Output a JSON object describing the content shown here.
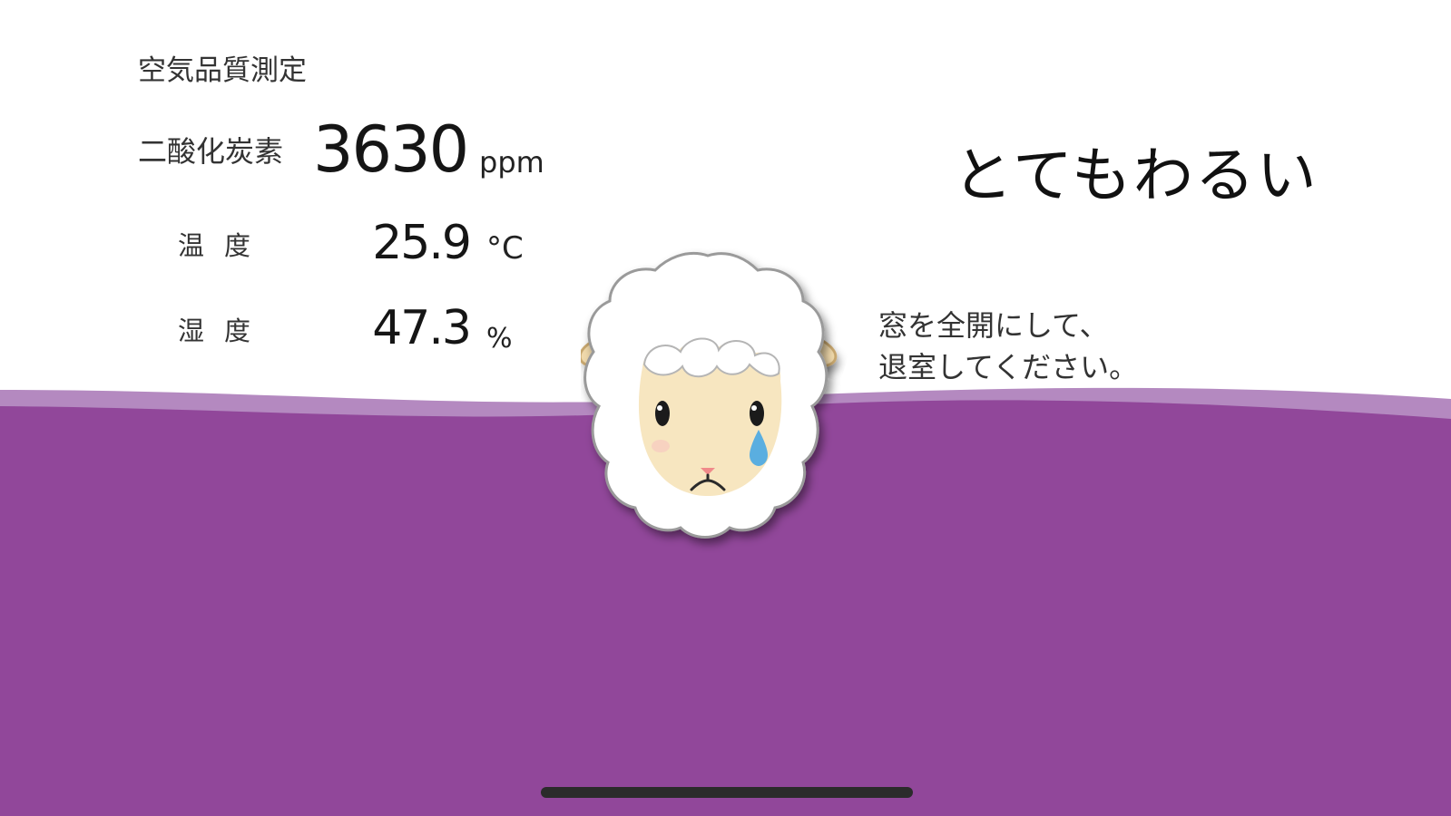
{
  "header": {
    "title": "空気品質測定"
  },
  "readings": {
    "co2": {
      "label": "二酸化炭素",
      "value": "3630",
      "unit": "ppm"
    },
    "temperature": {
      "label": "温度",
      "value": "25.9",
      "unit": "°C"
    },
    "humidity": {
      "label": "湿度",
      "value": "47.3",
      "unit": "%"
    }
  },
  "status": {
    "rating": "とてもわるい",
    "advice_line1": "窓を全開にして、",
    "advice_line2": "退室してください。"
  },
  "mascot": {
    "icon": "crying-sheep-icon",
    "mood": "sad"
  },
  "colors": {
    "background": "#ffffff",
    "wave_main": "#91479a",
    "wave_light": "#b489c0",
    "text": "#1a1a1a"
  }
}
